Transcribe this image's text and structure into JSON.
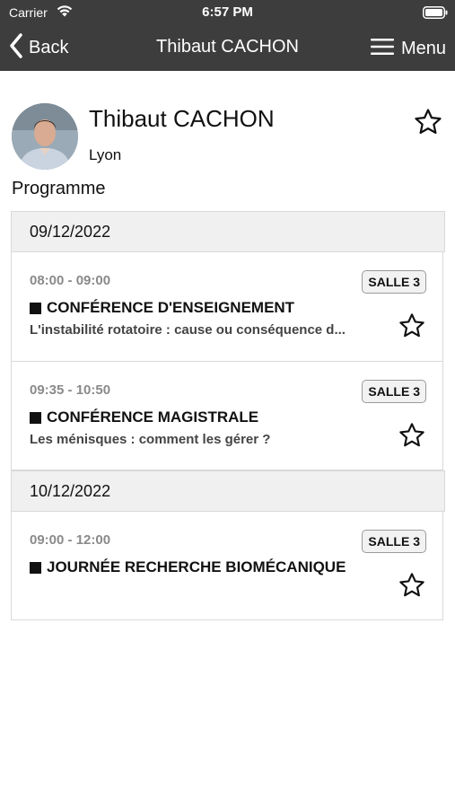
{
  "status_bar": {
    "carrier": "Carrier",
    "time": "6:57 PM"
  },
  "nav": {
    "back_label": "Back",
    "title": "Thibaut CACHON",
    "menu_label": "Menu"
  },
  "profile": {
    "name": "Thibaut CACHON",
    "city": "Lyon",
    "section_title": "Programme"
  },
  "days": [
    {
      "date": "09/12/2022",
      "sessions": [
        {
          "time": "08:00 - 09:00",
          "room": "SALLE 3",
          "type": "CONFÉRENCE D'ENSEIGNEMENT",
          "description": "L'instabilité rotatoire : cause ou conséquence d..."
        },
        {
          "time": "09:35 - 10:50",
          "room": "SALLE 3",
          "type": "CONFÉRENCE MAGISTRALE",
          "description": "Les ménisques : comment les gérer ?"
        }
      ]
    },
    {
      "date": "10/12/2022",
      "sessions": [
        {
          "time": "09:00 - 12:00",
          "room": "SALLE 3",
          "type": "JOURNÉE RECHERCHE BIOMÉCANIQUE",
          "description": ""
        }
      ]
    }
  ],
  "colors": {
    "header_bg": "#3d3d3d",
    "date_header_bg": "#f0f0f0",
    "muted_text": "#8a8a8a"
  },
  "icons": [
    "wifi-icon",
    "battery-icon",
    "back-chevron-icon",
    "hamburger-menu-icon",
    "star-outline-icon"
  ]
}
